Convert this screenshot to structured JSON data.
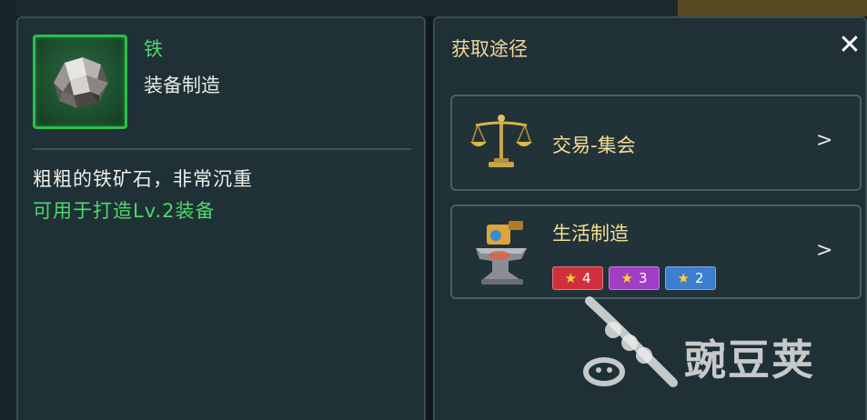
{
  "item": {
    "name": "铁",
    "type": "装备制造",
    "description": "粗粗的铁矿石，非常沉重",
    "usage": "可用于打造Lv.2装备",
    "icon": "iron-ore-icon"
  },
  "acquire": {
    "title": "获取途径",
    "close_icon": "close-icon",
    "routes": [
      {
        "label": "交易-集会",
        "icon": "scales-icon"
      },
      {
        "label": "生活制造",
        "icon": "anvil-icon",
        "badges": [
          {
            "level": "4",
            "color": "#d0303c"
          },
          {
            "level": "3",
            "color": "#a23ec6"
          },
          {
            "level": "2",
            "color": "#3c7ed0"
          }
        ]
      }
    ]
  },
  "watermark": {
    "text": "豌豆荚"
  },
  "colors": {
    "green": "#4fd86a",
    "gold": "#f0d79a",
    "panel": "#1f3036"
  }
}
